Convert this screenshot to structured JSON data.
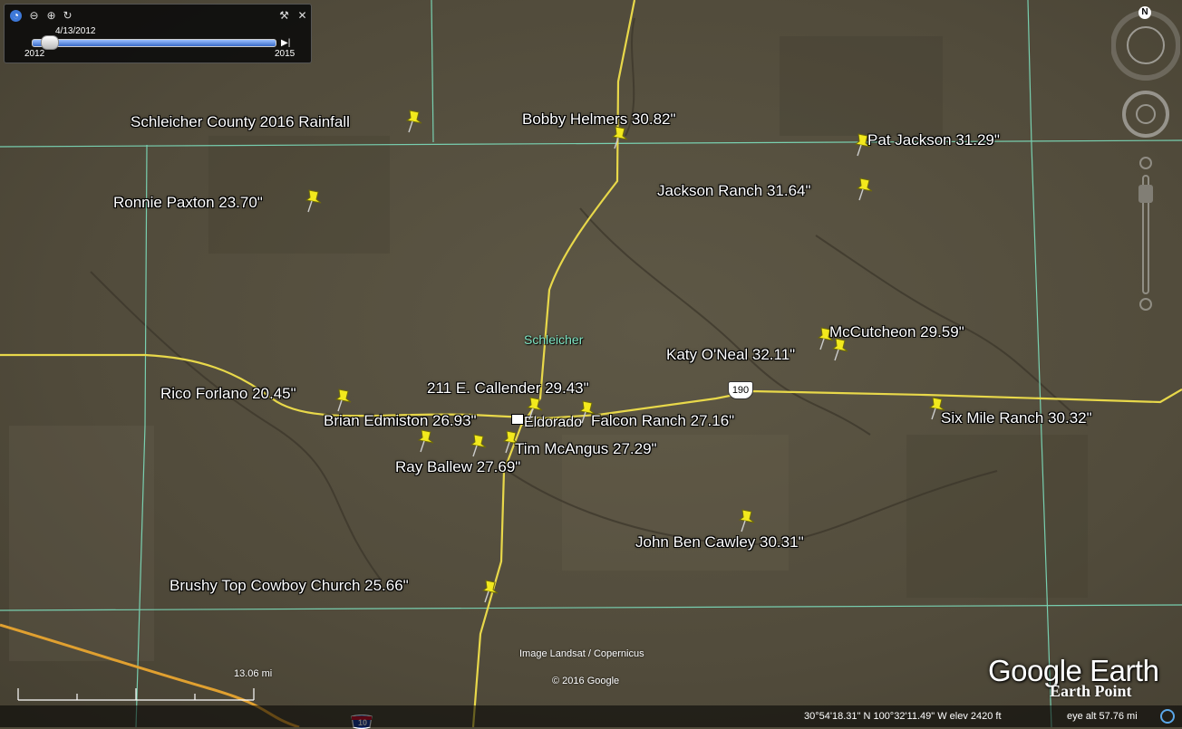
{
  "time_slider": {
    "current_date": "4/13/2012",
    "start_year": "2012",
    "end_year": "2015",
    "icons": [
      "clock-icon",
      "zoom-out-icon",
      "zoom-in-icon",
      "history-icon",
      "wrench-icon",
      "close-icon",
      "play-end-icon"
    ]
  },
  "placemarks": [
    {
      "label": "Schleicher County 2016 Rainfall"
    },
    {
      "label": "Bobby Helmers 30.82\""
    },
    {
      "label": "Pat Jackson 31.29\""
    },
    {
      "label": "Jackson Ranch 31.64\""
    },
    {
      "label": "Ronnie Paxton 23.70\""
    },
    {
      "label": "McCutcheon 29.59\""
    },
    {
      "label": "Katy O'Neal 32.11\""
    },
    {
      "label": "211 E. Callender 29.43\""
    },
    {
      "label": "Rico Forlano 20.45\""
    },
    {
      "label": "Brian Edmiston 26.93\""
    },
    {
      "label": "Falcon Ranch 27.16\""
    },
    {
      "label": "Six Mile Ranch 30.32\""
    },
    {
      "label": "Tim McAngus 27.29\""
    },
    {
      "label": "Ray Ballew 27.69\""
    },
    {
      "label": "John Ben Cawley 30.31\""
    },
    {
      "label": "Brushy Top Cowboy Church 25.66\""
    }
  ],
  "map_labels": {
    "county": "Schleicher",
    "town": "Eldorado",
    "highway_190": "190",
    "interstate": "10"
  },
  "nav": {
    "north": "N"
  },
  "scale": "13.06 mi",
  "credits": {
    "imagery": "Image Landsat / Copernicus",
    "copyright": "© 2016 Google"
  },
  "logos": {
    "google_earth": "Google Earth",
    "earth_point": "Earth Point"
  },
  "status": {
    "coords": "30°54'18.31\" N  100°32'11.49\" W  elev  2420 ft",
    "eye_alt": "eye alt  57.76 mi"
  },
  "colors": {
    "pin": "#f2e91d",
    "county_line": "#7fe6c4",
    "highway": "#e8d84a",
    "interstate": "#e0a030"
  }
}
